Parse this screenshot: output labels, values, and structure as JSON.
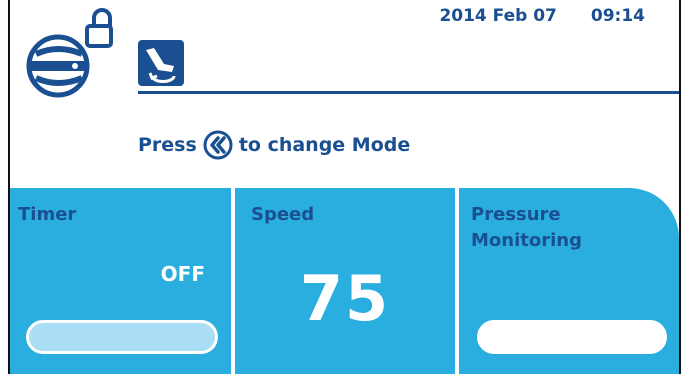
{
  "status": {
    "date": "2014 Feb 07",
    "time": "09:14"
  },
  "icons": {
    "pump": "pump-icon",
    "lock": "unlocked-padlock-icon",
    "mode": "chair-rotate-icon",
    "mode_key": "double-left-arrow-key-icon"
  },
  "hint": {
    "before": "Press",
    "after": "to change Mode"
  },
  "panels": {
    "timer": {
      "title": "Timer",
      "value": "OFF"
    },
    "speed": {
      "title": "Speed",
      "value": "75"
    },
    "pressure": {
      "title_line1": "Pressure",
      "title_line2": "Monitoring"
    }
  },
  "colors": {
    "accent": "#1a4f91",
    "panel": "#2aaee0",
    "timer_bar": "#a9def4"
  }
}
